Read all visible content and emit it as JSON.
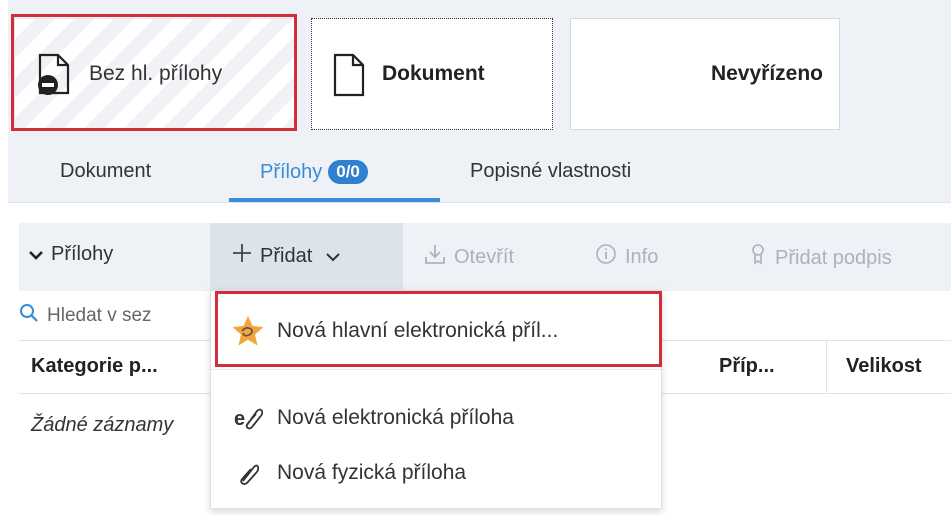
{
  "status_cards": {
    "card1_label": "Bez hl. přílohy",
    "card2_label": "Dokument",
    "card3_label": "Nevyřízeno"
  },
  "tabs": [
    {
      "label": "Dokument"
    },
    {
      "label": "Přílohy",
      "badge": "0/0",
      "active": true
    },
    {
      "label": "Popisné vlastnosti"
    }
  ],
  "toolbar": {
    "section_label": "Přílohy",
    "add_label": "Přidat",
    "open_label": "Otevřít",
    "info_label": "Info",
    "signature_label": "Přidat podpis"
  },
  "search": {
    "placeholder": "Hledat v sez"
  },
  "table": {
    "columns": [
      "Kategorie p...",
      "Příp...",
      "Velikost"
    ],
    "empty_text": "Žádné záznamy"
  },
  "dropdown": {
    "items": [
      {
        "label": "Nová hlavní elektronická příl...",
        "icon": "star-attachment-icon"
      },
      {
        "label": "Nová elektronická příloha",
        "icon": "electronic-attachment-icon"
      },
      {
        "label": "Nová fyzická příloha",
        "icon": "paperclip-icon"
      }
    ]
  },
  "colors": {
    "accent": "#3a8bd8",
    "badge": "#2f80cf",
    "highlight": "#d12d3b",
    "toolbar_bg": "#eef2f7"
  }
}
